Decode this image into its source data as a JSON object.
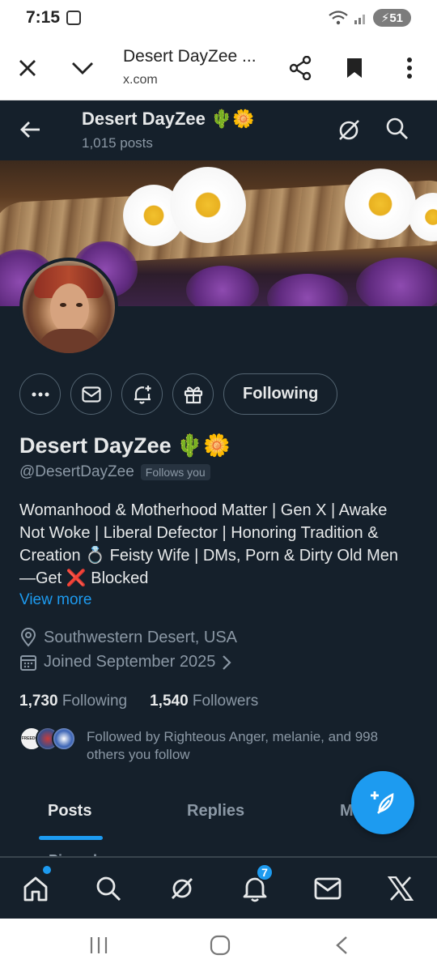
{
  "status_bar": {
    "time": "7:15",
    "battery": "51"
  },
  "browser": {
    "title": "Desert DayZee ...",
    "url": "x.com"
  },
  "header": {
    "name": "Desert DayZee 🌵🌼",
    "post_count": "1,015 posts"
  },
  "profile": {
    "following_button": "Following",
    "display_name": "Desert DayZee",
    "name_emoji": "🌵🌼",
    "handle": "@DesertDayZee",
    "follows_you": "Follows you",
    "bio_lines": [
      "Womanhood & Motherhood Matter | Gen X | Awake",
      "Not Woke | Liberal Defector | Honoring Tradition &",
      "Creation 💍 Feisty Wife | DMs, Porn & Dirty Old Men",
      "—Get ❌ Blocked"
    ],
    "view_more": "View more",
    "location": "Southwestern Desert, USA",
    "joined": "Joined September 2025",
    "following_count": "1,730",
    "following_label": "Following",
    "followers_count": "1,540",
    "followers_label": "Followers",
    "followed_by": "Followed by Righteous Anger, melanie, and 998 others you follow",
    "mini_avatar_label": "FREEDOM"
  },
  "tabs": [
    "Posts",
    "Replies",
    "M"
  ],
  "pinned_peek": "Pinned",
  "bottom_nav": {
    "notifications_badge": "7"
  },
  "colors": {
    "background": "#15202b",
    "accent": "#1d9bf0",
    "text": "#e7e9ea",
    "muted": "#8b98a5"
  }
}
